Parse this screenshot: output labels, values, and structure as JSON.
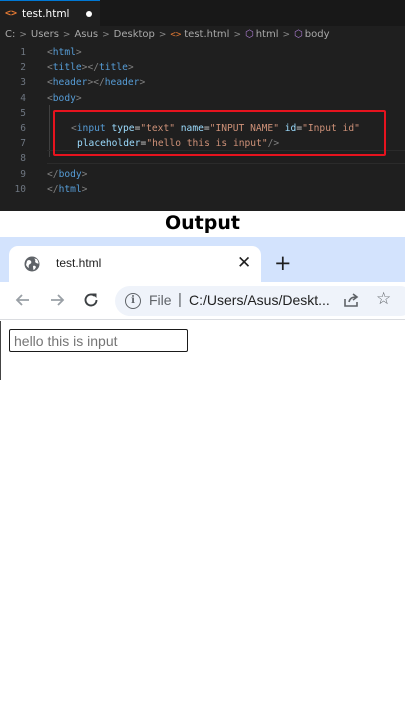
{
  "editor": {
    "tab": {
      "icon": "html-file-icon",
      "label": "test.html",
      "dirty_indicator": "unsaved-dot"
    },
    "breadcrumb": {
      "items": [
        "C:",
        "Users",
        "Asus",
        "Desktop",
        "test.html",
        "html",
        "body"
      ],
      "separator": ">"
    },
    "code_lines": [
      {
        "number": "1",
        "text": "<html>"
      },
      {
        "number": "2",
        "text": "<title></title>"
      },
      {
        "number": "3",
        "text": "<header></header>"
      },
      {
        "number": "4",
        "text": "<body>"
      },
      {
        "number": "5",
        "text": ""
      },
      {
        "number": "6",
        "text": "<input type=\"text\" name=\"INPUT NAME\" id=\"Input id\""
      },
      {
        "number": "7",
        "text": "placeholder=\"hello this is input\"/>"
      },
      {
        "number": "8",
        "text": ""
      },
      {
        "number": "9",
        "text": "</body>"
      },
      {
        "number": "10",
        "text": "</html>"
      }
    ],
    "highlight_color": "#e6131e"
  },
  "output_heading": "Output",
  "browser": {
    "tab_title": "test.html",
    "tab_icon": "globe-icon",
    "close_glyph": "✕",
    "new_tab_glyph": "+",
    "omnibox": {
      "scheme_label": "File",
      "separator": "|",
      "url": "C:/Users/Asus/Deskt..."
    },
    "page": {
      "input_placeholder": "hello this is input",
      "input_value": ""
    },
    "colors": {
      "tabstrip": "#d3e3fd",
      "omnibox": "#eff3fa"
    }
  }
}
